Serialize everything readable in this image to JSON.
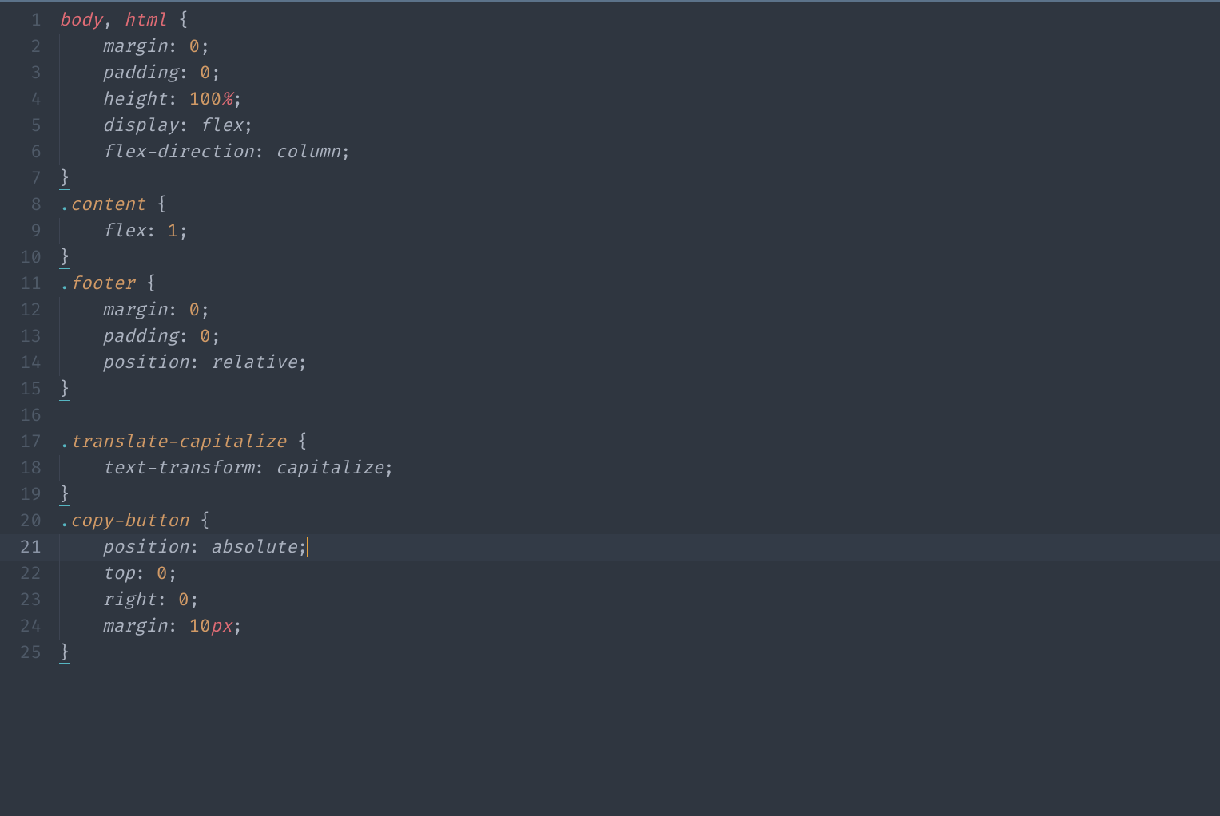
{
  "editor": {
    "activeLine": 21,
    "lines": [
      {
        "n": 1,
        "indent": 0,
        "segs": [
          [
            "tag",
            "body"
          ],
          [
            "punct",
            ", "
          ],
          [
            "tag",
            "html"
          ],
          [
            "punct",
            " "
          ],
          [
            "brace",
            "{"
          ]
        ]
      },
      {
        "n": 2,
        "indent": 1,
        "segs": [
          [
            "prop",
            "margin"
          ],
          [
            "punct",
            ": "
          ],
          [
            "num",
            "0"
          ],
          [
            "punct",
            ";"
          ]
        ]
      },
      {
        "n": 3,
        "indent": 1,
        "segs": [
          [
            "prop",
            "padding"
          ],
          [
            "punct",
            ": "
          ],
          [
            "num",
            "0"
          ],
          [
            "punct",
            ";"
          ]
        ]
      },
      {
        "n": 4,
        "indent": 1,
        "segs": [
          [
            "prop",
            "height"
          ],
          [
            "punct",
            ": "
          ],
          [
            "num",
            "100"
          ],
          [
            "unit",
            "%"
          ],
          [
            "punct",
            ";"
          ]
        ]
      },
      {
        "n": 5,
        "indent": 1,
        "segs": [
          [
            "prop",
            "display"
          ],
          [
            "punct",
            ": "
          ],
          [
            "kw",
            "flex"
          ],
          [
            "punct",
            ";"
          ]
        ]
      },
      {
        "n": 6,
        "indent": 1,
        "segs": [
          [
            "prop",
            "flex-direction"
          ],
          [
            "punct",
            ": "
          ],
          [
            "kw",
            "column"
          ],
          [
            "punct",
            ";"
          ]
        ]
      },
      {
        "n": 7,
        "indent": 0,
        "segs": [
          [
            "brace-u",
            "}"
          ]
        ]
      },
      {
        "n": 8,
        "indent": 0,
        "segs": [
          [
            "dot",
            "."
          ],
          [
            "class",
            "content"
          ],
          [
            "punct",
            " "
          ],
          [
            "brace",
            "{"
          ]
        ]
      },
      {
        "n": 9,
        "indent": 1,
        "segs": [
          [
            "prop",
            "flex"
          ],
          [
            "punct",
            ": "
          ],
          [
            "num",
            "1"
          ],
          [
            "punct",
            ";"
          ]
        ]
      },
      {
        "n": 10,
        "indent": 0,
        "segs": [
          [
            "brace-u",
            "}"
          ]
        ]
      },
      {
        "n": 11,
        "indent": 0,
        "segs": [
          [
            "dot",
            "."
          ],
          [
            "class",
            "footer"
          ],
          [
            "punct",
            " "
          ],
          [
            "brace",
            "{"
          ]
        ]
      },
      {
        "n": 12,
        "indent": 1,
        "segs": [
          [
            "prop",
            "margin"
          ],
          [
            "punct",
            ": "
          ],
          [
            "num",
            "0"
          ],
          [
            "punct",
            ";"
          ]
        ]
      },
      {
        "n": 13,
        "indent": 1,
        "segs": [
          [
            "prop",
            "padding"
          ],
          [
            "punct",
            ": "
          ],
          [
            "num",
            "0"
          ],
          [
            "punct",
            ";"
          ]
        ]
      },
      {
        "n": 14,
        "indent": 1,
        "segs": [
          [
            "prop",
            "position"
          ],
          [
            "punct",
            ": "
          ],
          [
            "kw",
            "relative"
          ],
          [
            "punct",
            ";"
          ]
        ]
      },
      {
        "n": 15,
        "indent": 0,
        "segs": [
          [
            "brace-u",
            "}"
          ]
        ]
      },
      {
        "n": 16,
        "indent": 0,
        "segs": []
      },
      {
        "n": 17,
        "indent": 0,
        "segs": [
          [
            "dot",
            "."
          ],
          [
            "class",
            "translate-capitalize"
          ],
          [
            "punct",
            " "
          ],
          [
            "brace",
            "{"
          ]
        ]
      },
      {
        "n": 18,
        "indent": 1,
        "segs": [
          [
            "prop",
            "text-transform"
          ],
          [
            "punct",
            ": "
          ],
          [
            "kw",
            "capitalize"
          ],
          [
            "punct",
            ";"
          ]
        ]
      },
      {
        "n": 19,
        "indent": 0,
        "segs": [
          [
            "brace-u",
            "}"
          ]
        ]
      },
      {
        "n": 20,
        "indent": 0,
        "segs": [
          [
            "dot",
            "."
          ],
          [
            "class",
            "copy-button"
          ],
          [
            "punct",
            " "
          ],
          [
            "brace",
            "{"
          ]
        ]
      },
      {
        "n": 21,
        "indent": 1,
        "segs": [
          [
            "prop",
            "position"
          ],
          [
            "punct",
            ": "
          ],
          [
            "kw",
            "absolute"
          ],
          [
            "punct",
            ";"
          ],
          [
            "cursor",
            ""
          ]
        ]
      },
      {
        "n": 22,
        "indent": 1,
        "segs": [
          [
            "prop",
            "top"
          ],
          [
            "punct",
            ": "
          ],
          [
            "num",
            "0"
          ],
          [
            "punct",
            ";"
          ]
        ]
      },
      {
        "n": 23,
        "indent": 1,
        "segs": [
          [
            "prop",
            "right"
          ],
          [
            "punct",
            ": "
          ],
          [
            "num",
            "0"
          ],
          [
            "punct",
            ";"
          ]
        ]
      },
      {
        "n": 24,
        "indent": 1,
        "segs": [
          [
            "prop",
            "margin"
          ],
          [
            "punct",
            ": "
          ],
          [
            "num",
            "10"
          ],
          [
            "unit",
            "px"
          ],
          [
            "punct",
            ";"
          ]
        ]
      },
      {
        "n": 25,
        "indent": 0,
        "segs": [
          [
            "brace-u",
            "}"
          ]
        ]
      }
    ]
  }
}
